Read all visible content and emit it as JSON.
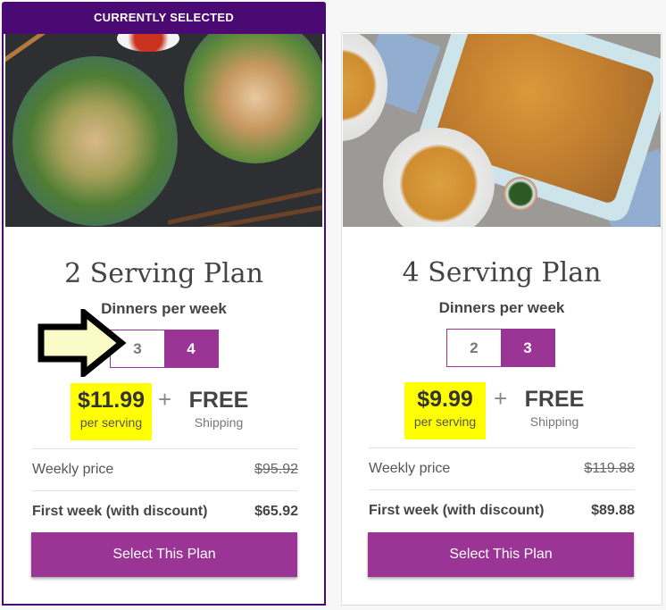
{
  "plans": [
    {
      "banner": "CURRENTLY SELECTED",
      "photo": "tofu-salad-bowls-photo",
      "title": "2 Serving Plan",
      "dinners_label": "Dinners per week",
      "options": [
        "3",
        "4"
      ],
      "selected_option": "4",
      "price": "$11.99",
      "price_unit": "per serving",
      "plus": "+",
      "shipping_main": "FREE",
      "shipping_sub": "Shipping",
      "weekly_label": "Weekly price",
      "weekly_value": "$95.92",
      "first_week_label": "First week (with discount)",
      "first_week_value": "$65.92",
      "button_label": "Select This Plan"
    },
    {
      "photo": "mac-and-cheese-casserole-photo",
      "title": "4 Serving Plan",
      "dinners_label": "Dinners per week",
      "options": [
        "2",
        "3"
      ],
      "selected_option": "3",
      "price": "$9.99",
      "price_unit": "per serving",
      "plus": "+",
      "shipping_main": "FREE",
      "shipping_sub": "Shipping",
      "weekly_label": "Weekly price",
      "weekly_value": "$119.88",
      "first_week_label": "First week (with discount)",
      "first_week_value": "$89.88",
      "button_label": "Select This Plan"
    }
  ],
  "annotation": {
    "icon": "arrow-right-icon",
    "points_to": "3"
  },
  "colors": {
    "selected_border": "#4b0a73",
    "accent_purple": "#9b3595",
    "highlight_yellow": "#ffff00",
    "arrow_fill": "#fbfbc8"
  }
}
